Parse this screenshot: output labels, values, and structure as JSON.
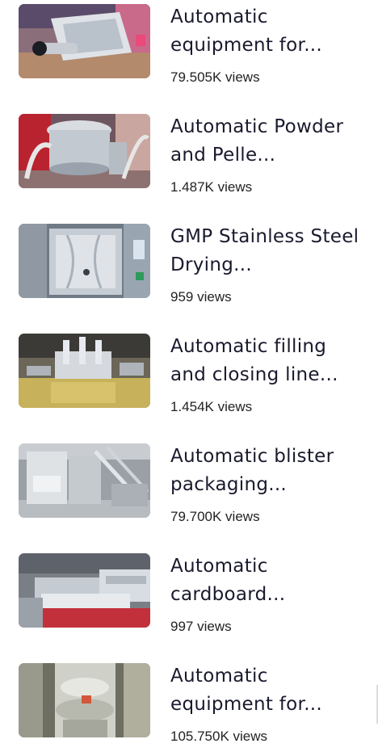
{
  "videos": [
    {
      "title": "Automatic equipment for...",
      "views": "79.505K views"
    },
    {
      "title": "Automatic Powder and Pelle...",
      "views": "1.487K views"
    },
    {
      "title": "GMP Stainless Steel Drying...",
      "views": "959 views"
    },
    {
      "title": "Automatic filling and closing line...",
      "views": "1.454K views"
    },
    {
      "title": "Automatic blister packaging...",
      "views": "79.700K views"
    },
    {
      "title": "Automatic cardboard...",
      "views": "997 views"
    },
    {
      "title": "Automatic equipment for...",
      "views": "105.750K views"
    }
  ]
}
